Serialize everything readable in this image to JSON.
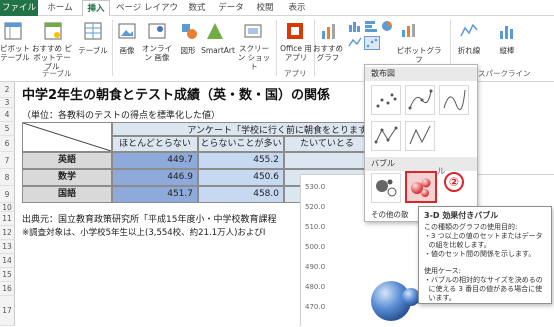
{
  "tabs": [
    "ファイル",
    "ホーム",
    "挿入",
    "ページ レイアウト",
    "数式",
    "データ",
    "校閲",
    "表示"
  ],
  "ribbon": {
    "pivot_table": "ピボット テーブル",
    "recommended_pivot": "おすすめ ピボットテーブル",
    "table": "テーブル",
    "picture": "画像",
    "online_picture": "オンライン 画像",
    "shapes": "図形",
    "smartart": "SmartArt",
    "screenshot": "スクリーン ショット",
    "office_apps": "Office 用 アプリ",
    "recommended_charts": "おすすめ グラフ",
    "pivot_chart": "ピボットグラフ",
    "line": "折れ線",
    "column": "縦棒",
    "group_table": "テーブル",
    "group_apps": "アプリ",
    "group_sparkline": "スパークライン"
  },
  "sheet": {
    "title": "中学2年生の朝食とテスト成績（英・数・国）の関係",
    "note": "（単位：各教科のテストの得点を標準化した値）",
    "survey_header": "アンケート「学校に行く前に朝食をとります",
    "col1": "ほとんどとらない",
    "col2": "とらないことが多い",
    "col3": "たいていとる",
    "rows": [
      {
        "label": "英語",
        "v1": "449.7",
        "v2": "455.2"
      },
      {
        "label": "数学",
        "v1": "446.9",
        "v2": "450.6"
      },
      {
        "label": "国語",
        "v1": "451.7",
        "v2": "458.0"
      }
    ],
    "source": "出典元：国立教育政策研究所「平成15年度小・中学校教育課程",
    "footnote": "※調査対象は、小学校5年生以上(3,554校、約21.1万人)およびⅠ",
    "row_numbers": [
      "2",
      "3",
      "4",
      "5",
      "6",
      "7",
      "8",
      "9",
      "10",
      "11",
      "12",
      "13",
      "14",
      "15",
      "16",
      "17"
    ],
    "chart_ticks": [
      "530.0",
      "520.0",
      "510.0",
      "500.0",
      "490.0",
      "480.0",
      "470.0"
    ]
  },
  "dropdown": {
    "scatter_header": "散布図",
    "bubble_header": "バブル",
    "more_label": "その他の散",
    "bubble_partial": "ル"
  },
  "step_marker": "②",
  "tooltip": {
    "title": "3-D 効果付きバブル",
    "lines": [
      "この種類のグラフの使用目的:",
      "・3 つ以上の値のセットまたはデータ",
      "  の組を比較します。",
      "・値のセット間の関係を示します。",
      "",
      "使用ケース:",
      "・バブルの相対的なサイズを決めるの",
      "  に使える 3 番目の値がある場合に使",
      "  います。"
    ]
  },
  "colors": {
    "excel_green": "#217346",
    "accent_red": "#d9262c",
    "selection_blue": "#a9c4eb"
  }
}
